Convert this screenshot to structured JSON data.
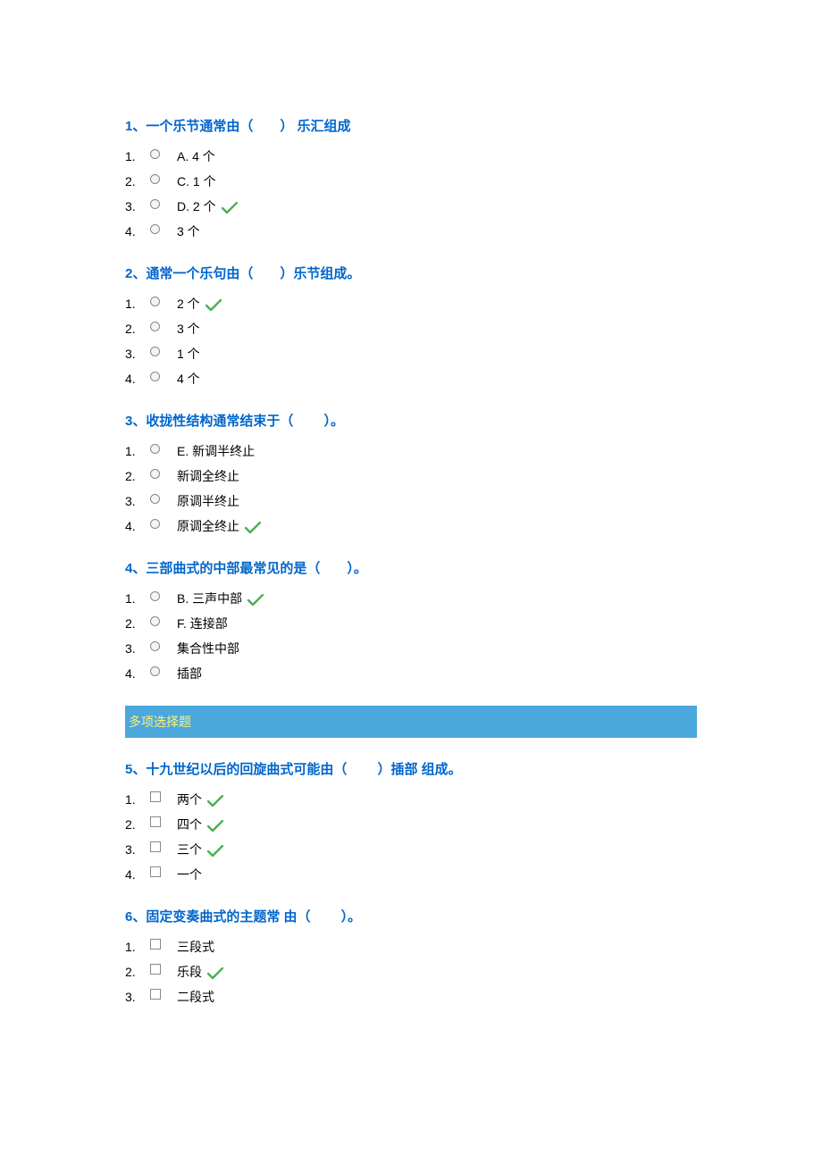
{
  "questions": [
    {
      "number": "1",
      "title": "、一个乐节通常由（　　） 乐汇组成",
      "type": "radio",
      "options": [
        {
          "num": "1.",
          "text": "A. 4 个",
          "correct": false
        },
        {
          "num": "2.",
          "text": "C. 1 个",
          "correct": false
        },
        {
          "num": "3.",
          "text": "D. 2 个",
          "correct": true
        },
        {
          "num": "4.",
          "text": "3 个",
          "correct": false
        }
      ]
    },
    {
      "number": "2",
      "title": "、通常一个乐句由（　　）乐节组成。",
      "type": "radio",
      "options": [
        {
          "num": "1.",
          "text": "2 个",
          "correct": true
        },
        {
          "num": "2.",
          "text": "3 个",
          "correct": false
        },
        {
          "num": "3.",
          "text": "1 个",
          "correct": false
        },
        {
          "num": "4.",
          "text": "4 个",
          "correct": false
        }
      ]
    },
    {
      "number": "3",
      "title": "、收拢性结构通常结束于（　　 ）。",
      "type": "radio",
      "options": [
        {
          "num": "1.",
          "text": "E. 新调半终止",
          "correct": false
        },
        {
          "num": "2.",
          "text": "新调全终止",
          "correct": false
        },
        {
          "num": "3.",
          "text": "原调半终止",
          "correct": false
        },
        {
          "num": "4.",
          "text": "原调全终止",
          "correct": true
        }
      ]
    },
    {
      "number": "4",
      "title": "、三部曲式的中部最常见的是（　　）。",
      "type": "radio",
      "options": [
        {
          "num": "1.",
          "text": "B. 三声中部",
          "correct": true
        },
        {
          "num": "2.",
          "text": "F. 连接部",
          "correct": false
        },
        {
          "num": "3.",
          "text": "集合性中部",
          "correct": false
        },
        {
          "num": "4.",
          "text": "插部",
          "correct": false
        }
      ]
    }
  ],
  "section_header": "多项选择题",
  "questions2": [
    {
      "number": "5",
      "title": "、十九世纪以后的回旋曲式可能由（　　 ）插部 组成。",
      "type": "checkbox",
      "options": [
        {
          "num": "1.",
          "text": "两个",
          "correct": true
        },
        {
          "num": "2.",
          "text": "四个",
          "correct": true
        },
        {
          "num": "3.",
          "text": "三个",
          "correct": true
        },
        {
          "num": "4.",
          "text": "一个",
          "correct": false
        }
      ]
    },
    {
      "number": "6",
      "title": "、固定变奏曲式的主题常 由（ 　　）。",
      "type": "checkbox",
      "options": [
        {
          "num": "1.",
          "text": "三段式",
          "correct": false
        },
        {
          "num": "2.",
          "text": "乐段",
          "correct": true
        },
        {
          "num": "3.",
          "text": "二段式",
          "correct": false
        }
      ]
    }
  ]
}
